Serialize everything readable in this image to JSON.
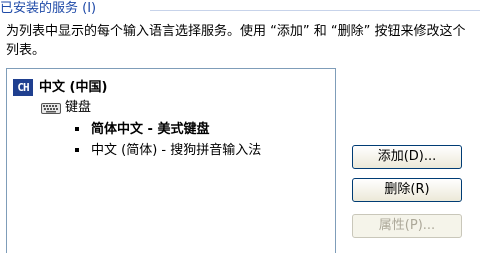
{
  "group": {
    "title": "已安装的服务 (I)"
  },
  "description": "为列表中显示的每个输入语言选择服务。使用 “添加” 和 “删除” 按钮来修改这个列表。",
  "list": {
    "language": {
      "code": "CH",
      "label": "中文 (中国)"
    },
    "category": {
      "label": "键盘",
      "icon": "keyboard-icon"
    },
    "services": [
      {
        "label": "简体中文 - 美式键盘",
        "selected": true
      },
      {
        "label": "中文 (简体) - 搜狗拼音输入法",
        "selected": false
      }
    ]
  },
  "buttons": {
    "add_label": "添加(D)...",
    "remove_label": "删除(R)",
    "properties_label": "属性(P)..."
  },
  "colors": {
    "group_title": "#1f4aa8",
    "language_badge": "#1f3f8f",
    "list_border": "#7f9db9",
    "button_border": "#003c74",
    "disabled_text": "#aca899"
  }
}
